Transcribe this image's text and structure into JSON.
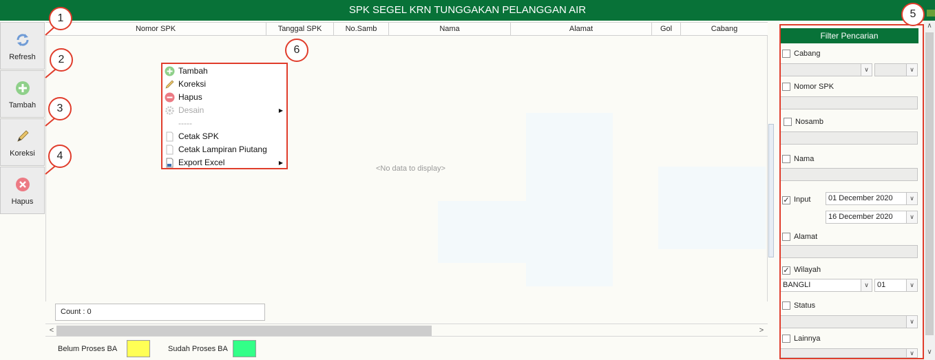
{
  "window": {
    "title": "SPK SEGEL KRN TUNGGAKAN PELANGGAN AIR"
  },
  "toolbar": {
    "refresh": "Refresh",
    "tambah": "Tambah",
    "koreksi": "Koreksi",
    "hapus": "Hapus"
  },
  "grid": {
    "columns": [
      "Nomor SPK",
      "Tanggal SPK",
      "No.Samb",
      "Nama",
      "Alamat",
      "Gol",
      "Cabang"
    ],
    "empty_text": "<No data to display>",
    "count_text": "Count : 0"
  },
  "legend": {
    "belum": "Belum Proses BA",
    "sudah": "Sudah Proses BA",
    "belum_color": "#ffff55",
    "sudah_color": "#33ff88"
  },
  "filter": {
    "title": "Filter Pencarian",
    "cabang": "Cabang",
    "nomor_spk": "Nomor SPK",
    "nosamb": "Nosamb",
    "nama": "Nama",
    "input": "Input",
    "date_from": "01 December 2020",
    "date_to": "16 December 2020",
    "alamat": "Alamat",
    "wilayah": "Wilayah",
    "wilayah_value": "BANGLI",
    "wilayah_sub": "01",
    "status": "Status",
    "lainnya": "Lainnya",
    "checked": {
      "input": true,
      "wilayah": true
    }
  },
  "context_menu": {
    "items": [
      "Tambah",
      "Koreksi",
      "Hapus",
      "Desain",
      "-----",
      "Cetak SPK",
      "Cetak Lampiran Piutang",
      "Export Excel"
    ]
  },
  "callouts": [
    "1",
    "2",
    "3",
    "4",
    "5",
    "6"
  ],
  "colors": {
    "accent": "#087238",
    "annotation": "#e03c2b"
  }
}
